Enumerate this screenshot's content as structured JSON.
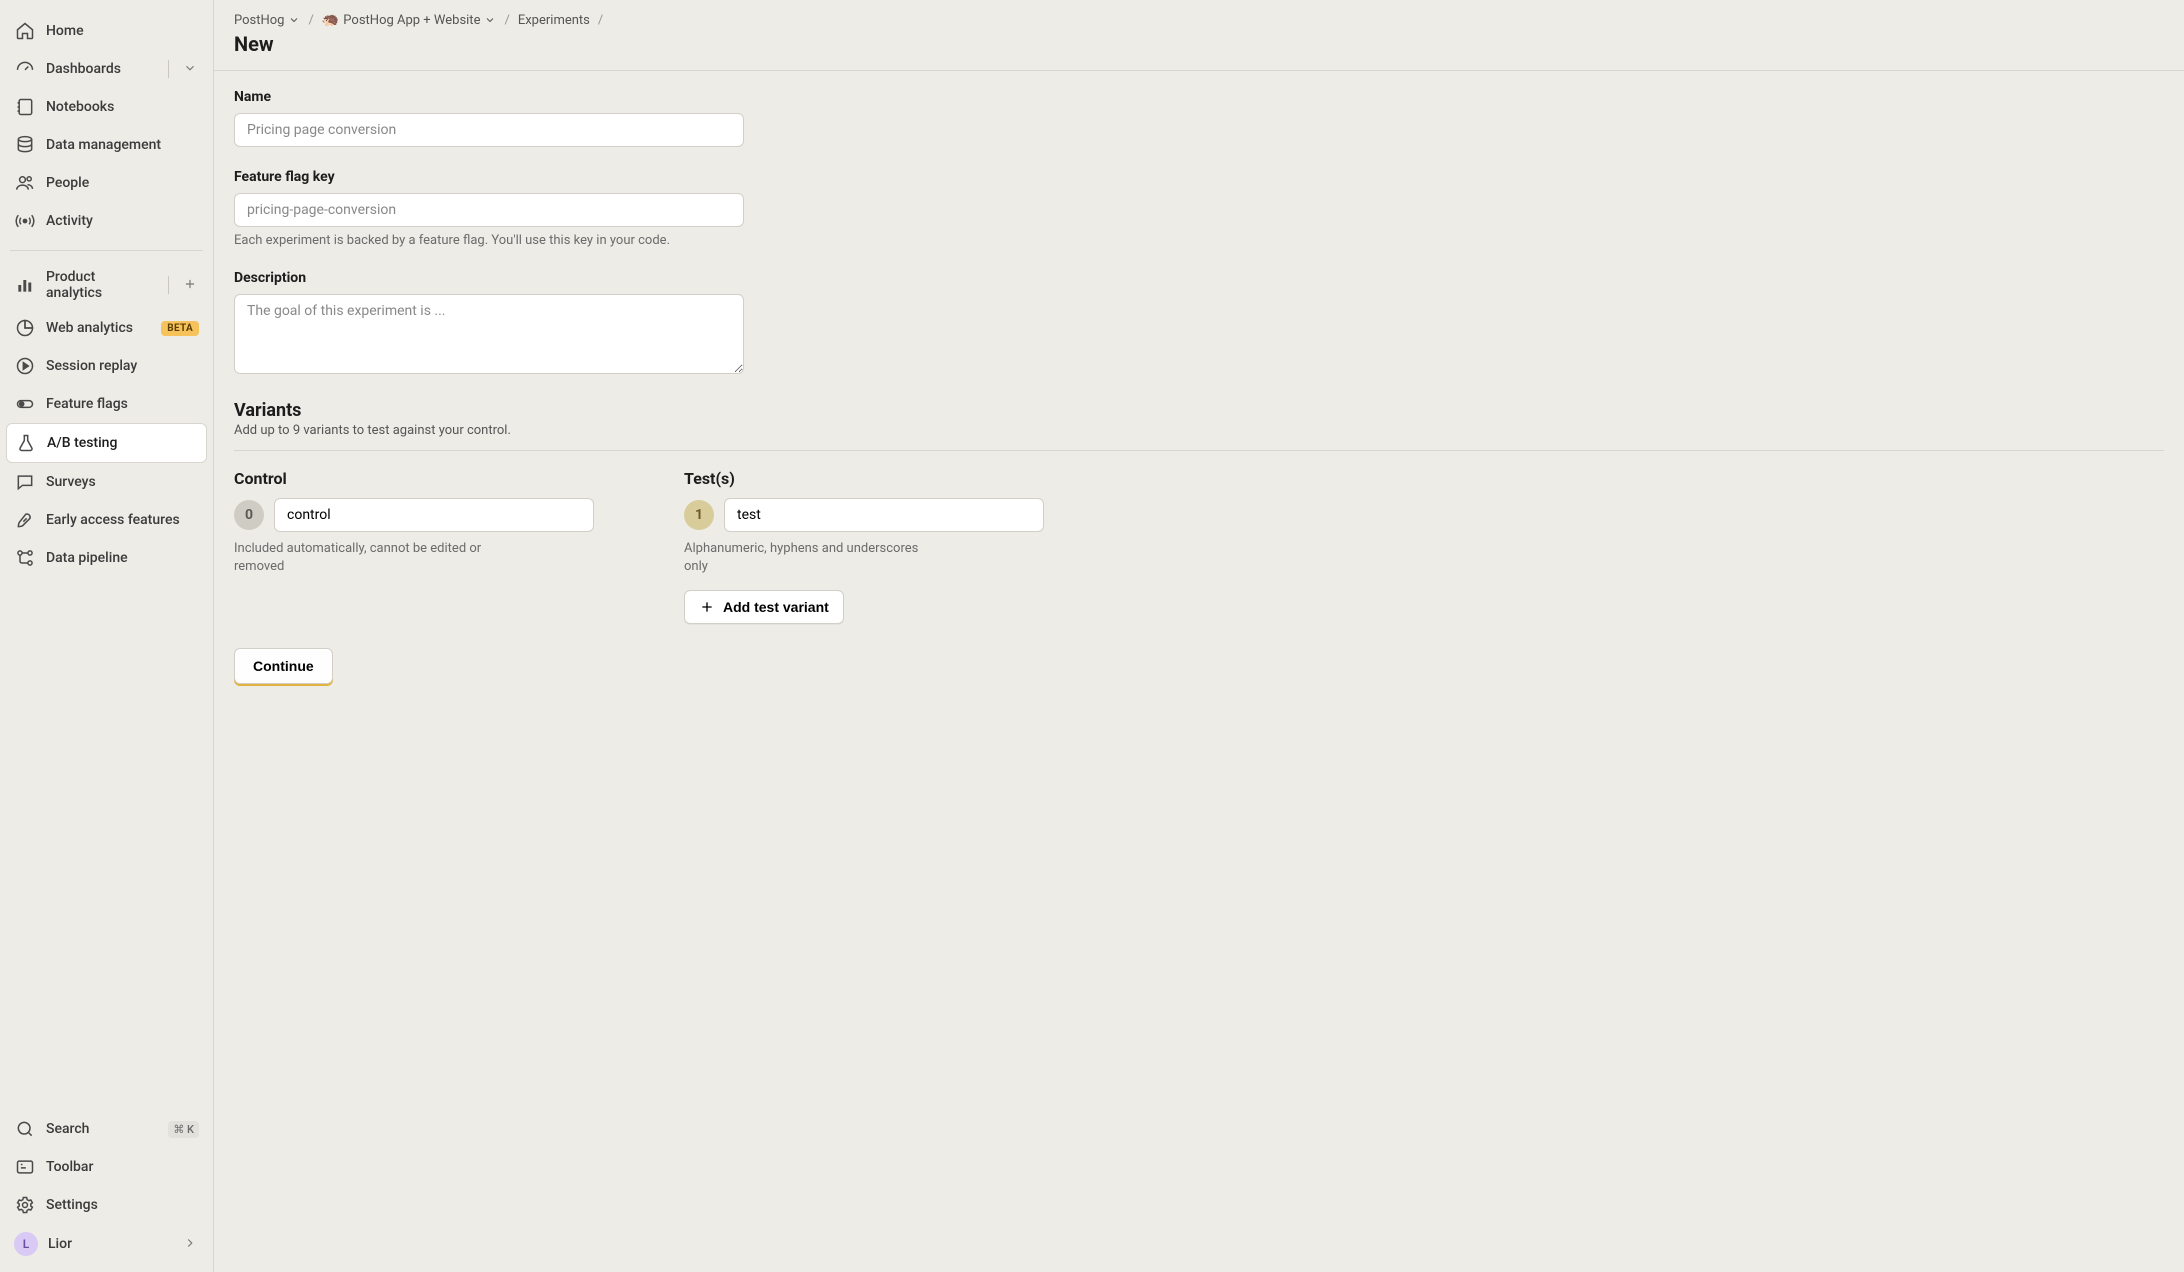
{
  "sidebar": {
    "top": [
      {
        "id": "home",
        "label": "Home"
      },
      {
        "id": "dashboards",
        "label": "Dashboards",
        "chevron": true
      },
      {
        "id": "notebooks",
        "label": "Notebooks"
      },
      {
        "id": "data-management",
        "label": "Data management"
      },
      {
        "id": "people",
        "label": "People"
      },
      {
        "id": "activity",
        "label": "Activity"
      }
    ],
    "mid": [
      {
        "id": "product-analytics",
        "label": "Product analytics",
        "plus": true
      },
      {
        "id": "web-analytics",
        "label": "Web analytics",
        "beta": true
      },
      {
        "id": "session-replay",
        "label": "Session replay"
      },
      {
        "id": "feature-flags",
        "label": "Feature flags"
      },
      {
        "id": "ab-testing",
        "label": "A/B testing",
        "active": true
      },
      {
        "id": "surveys",
        "label": "Surveys"
      },
      {
        "id": "early-access",
        "label": "Early access features"
      },
      {
        "id": "data-pipeline",
        "label": "Data pipeline"
      }
    ],
    "bottom": [
      {
        "id": "search",
        "label": "Search",
        "kbd": "⌘ K"
      },
      {
        "id": "toolbar",
        "label": "Toolbar"
      },
      {
        "id": "settings",
        "label": "Settings"
      }
    ],
    "user": {
      "initial": "L",
      "name": "Lior"
    },
    "beta_badge": "BETA"
  },
  "breadcrumb": {
    "items": [
      "PostHog",
      "PostHog App + Website",
      "Experiments"
    ],
    "current": "New"
  },
  "form": {
    "name_label": "Name",
    "name_placeholder": "Pricing page conversion",
    "ffk_label": "Feature flag key",
    "ffk_placeholder": "pricing-page-conversion",
    "ffk_help": "Each experiment is backed by a feature flag. You'll use this key in your code.",
    "desc_label": "Description",
    "desc_placeholder": "The goal of this experiment is ..."
  },
  "variants": {
    "title": "Variants",
    "subtitle": "Add up to 9 variants to test against your control.",
    "control_heading": "Control",
    "control_badge": "0",
    "control_value": "control",
    "control_help": "Included automatically, cannot be edited or removed",
    "tests_heading": "Test(s)",
    "test_badge": "1",
    "test_value": "test",
    "test_help": "Alphanumeric, hyphens and underscores only",
    "add_test_label": "Add test variant"
  },
  "continue_label": "Continue"
}
